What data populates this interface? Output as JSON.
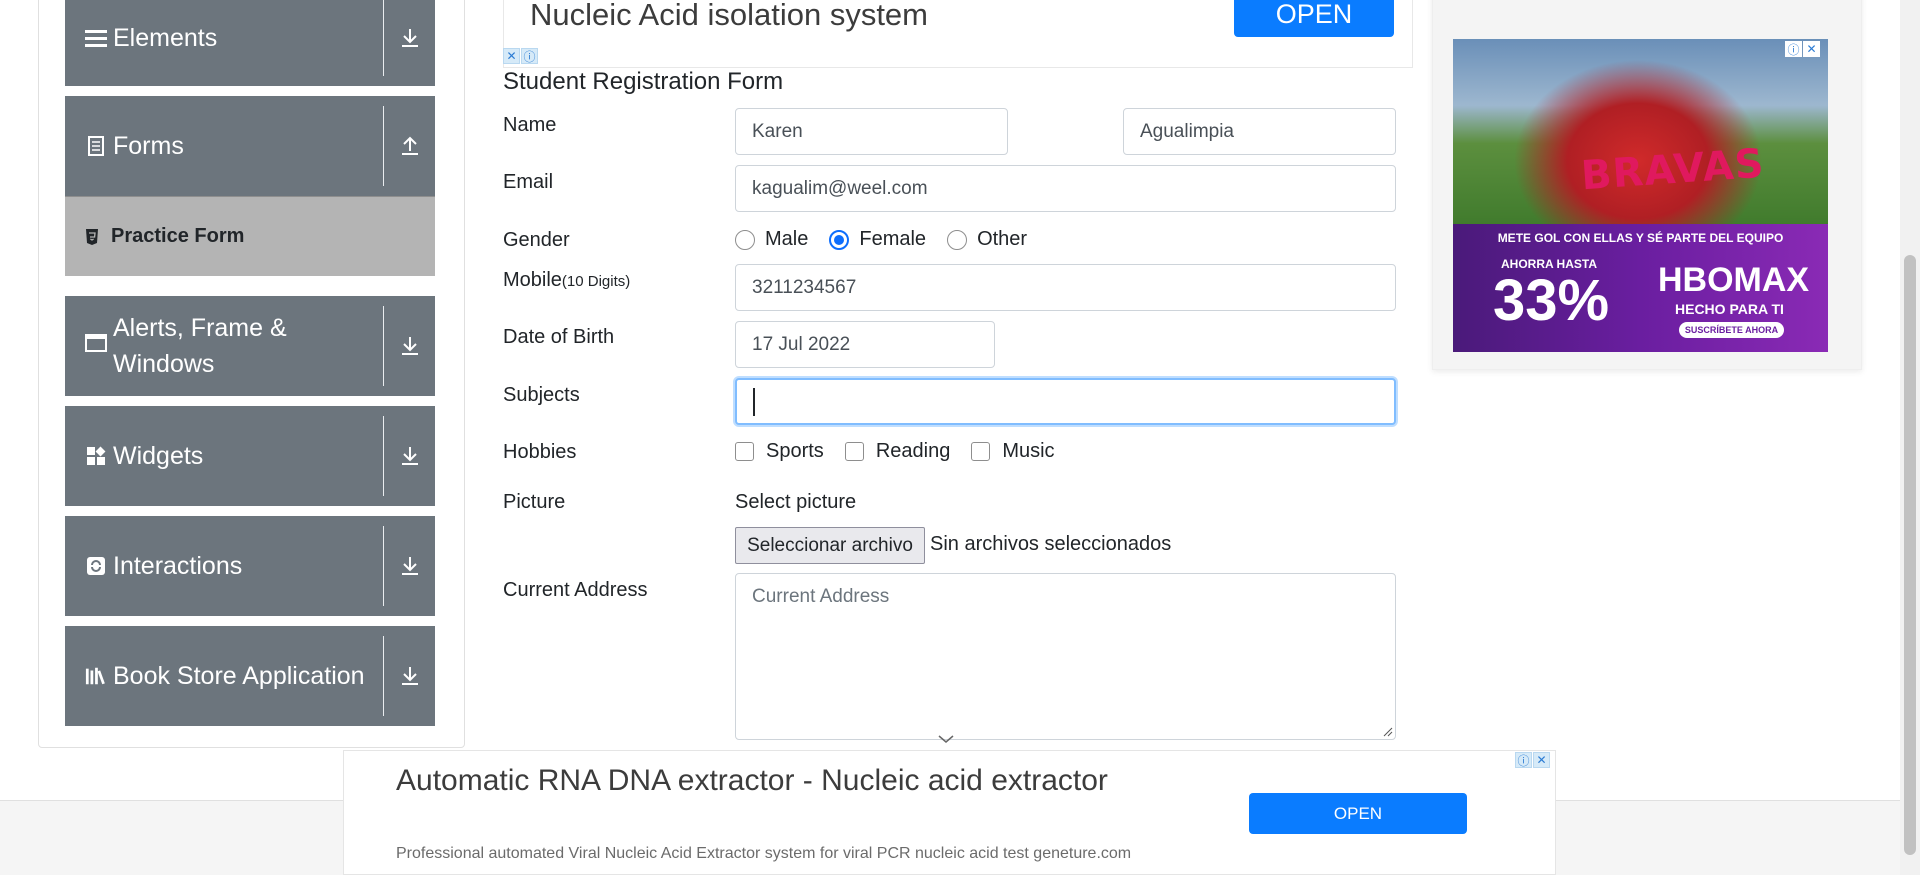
{
  "sidebar": {
    "groups": [
      {
        "label": "Elements",
        "icon": "hamburger-icon",
        "toggle": "download-icon"
      },
      {
        "label": "Forms",
        "icon": "document-icon",
        "toggle": "upload-icon"
      },
      {
        "label": "Alerts, Frame & Windows",
        "icon": "window-icon",
        "toggle": "download-icon"
      },
      {
        "label": "Widgets",
        "icon": "widgets-icon",
        "toggle": "download-icon"
      },
      {
        "label": "Interactions",
        "icon": "refresh-icon",
        "toggle": "download-icon"
      },
      {
        "label": "Book Store Application",
        "icon": "books-icon",
        "toggle": "download-icon"
      }
    ],
    "active_item": {
      "label": "Practice Form",
      "icon": "html5-icon"
    }
  },
  "top_ad": {
    "text": "Nucleic Acid isolation system",
    "button": "OPEN"
  },
  "form": {
    "title": "Student Registration Form",
    "name_label": "Name",
    "first_name": "Karen",
    "last_name": "Agualimpia",
    "email_label": "Email",
    "email": "kagualim@weel.com",
    "gender_label": "Gender",
    "gender_options": [
      "Male",
      "Female",
      "Other"
    ],
    "gender_selected": "Female",
    "mobile_label": "Mobile",
    "mobile_hint": "(10 Digits)",
    "mobile": "3211234567",
    "dob_label": "Date of Birth",
    "dob": "17 Jul 2022",
    "subjects_label": "Subjects",
    "subjects_value": "",
    "hobbies_label": "Hobbies",
    "hobbies": [
      "Sports",
      "Reading",
      "Music"
    ],
    "picture_label": "Picture",
    "picture_prompt": "Select picture",
    "file_button": "Seleccionar archivo",
    "file_status": "Sin archivos seleccionados",
    "address_label": "Current Address",
    "address_placeholder": "Current Address"
  },
  "right_ad": {
    "brand_top": "BRAVAS",
    "tagline": "METE GOL CON ELLAS Y SÉ PARTE DEL EQUIPO",
    "upto": "AHORRA HASTA",
    "discount": "33%",
    "brand": "HBOMAX",
    "brand_sub": "HECHO PARA TI",
    "cta": "SUSCRÍBETE AHORA"
  },
  "bottom_ad": {
    "headline": "Automatic RNA DNA extractor - Nucleic acid extractor",
    "description": "Professional automated Viral Nucleic Acid Extractor system for viral PCR nucleic acid test geneture.com",
    "button": "OPEN"
  },
  "colors": {
    "sidebar_bg": "#6c757d",
    "active_item_bg": "#b4b4b4",
    "accent": "#0d6efd",
    "ad_button": "#0a7cff"
  }
}
